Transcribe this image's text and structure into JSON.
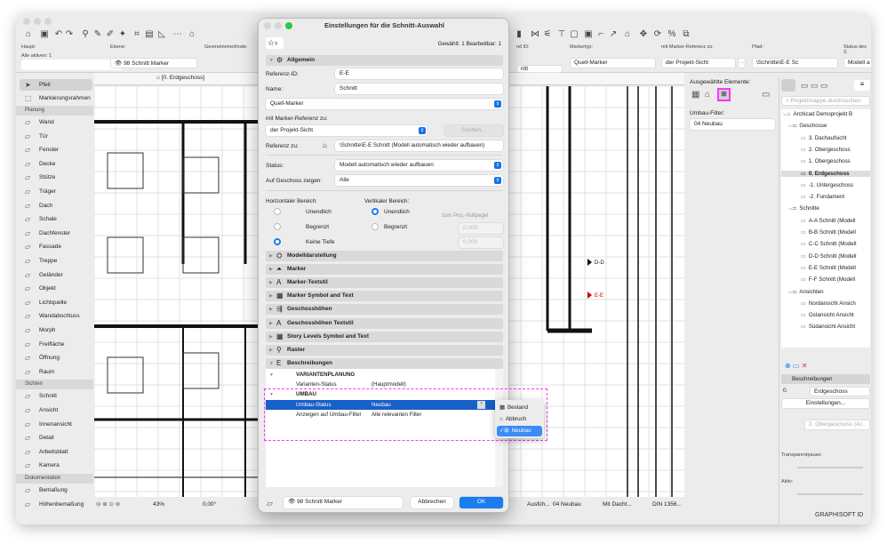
{
  "toolbar": {
    "icons": [
      "home-icon",
      "save-icon",
      "undo-icon",
      "redo-icon",
      "find-select-icon",
      "eyedropper-icon",
      "syringe-icon",
      "magic-wand-icon",
      "fit-icon",
      "layout-icon",
      "angle-icon",
      "snap-icon",
      "roof-icon",
      "wall-icon",
      "trim-icon",
      "adjust-icon",
      "intersect-icon",
      "offset-icon",
      "split-icon",
      "resize-icon",
      "stretch-icon",
      "elevate-icon",
      "move-icon",
      "rotate-icon",
      "percent-icon",
      "duplicate-icon"
    ]
  },
  "infobox": {
    "haupt_label": "Haupt:",
    "alle_aktiven": "Alle aktiven: 1",
    "ebene_label": "Ebene:",
    "ebene_value": "98 Schnitt Marker",
    "geometrie_label": "Geometriemethode:",
    "id_label": "nd ID:",
    "id_value": "nitt",
    "markertyp_label": "Markertyp:",
    "markertyp_value": "Quell-Marker",
    "marker_ref_label": "mit Marker-Referenz zu:",
    "marker_ref_value": "der Projekt-Sicht",
    "more_button": "...",
    "pfad_label": "Pfad:",
    "pfad_value": "\\Schnitte\\E-E Sc",
    "status_label": "Status des S",
    "status_value": "Modell a"
  },
  "view_tab": {
    "label": "[0. Erdgeschoss]"
  },
  "toolbox": {
    "top": [
      {
        "label": "Pfeil",
        "icon": "arrow-pointer-icon"
      },
      {
        "label": "Markierungsrahmen",
        "icon": "marquee-icon"
      }
    ],
    "sections": [
      {
        "title": "Planung",
        "items": [
          "Wand",
          "Tür",
          "Fenster",
          "Decke",
          "Stütze",
          "Träger",
          "Dach",
          "Schale",
          "Dachfenster",
          "Fassade",
          "Treppe",
          "Geländer",
          "Objekt",
          "Lichtquelle",
          "Wandabschluss",
          "Morph",
          "Freifläche",
          "Öffnung",
          "Raum"
        ]
      },
      {
        "title": "Sichten",
        "items": [
          "Schnitt",
          "Ansicht",
          "Innenansicht",
          "Detail",
          "Arbeitsblatt",
          "Kamera"
        ]
      },
      {
        "title": "Dokumentation",
        "items": [
          "Bemaßung",
          "Höhenbemaßung"
        ]
      }
    ]
  },
  "canvas": {
    "markers": [
      "D-D",
      "E-E"
    ],
    "marker_color": "#cc0000"
  },
  "statusbar": {
    "zoom": "43%",
    "angle": "0,00°",
    "item1": "Ausfüh...",
    "renovation": "04 Neubau",
    "model": "Mit Dacht...",
    "scale": "DIN 1356..."
  },
  "dialog": {
    "title": "Einstellungen für die Schnitt-Auswahl",
    "selection_info": "Gewählt: 1 Bearbeitbar: 1",
    "allgemein": "Allgemein",
    "ref_id_label": "Referenz-ID:",
    "ref_id_value": "E-E",
    "name_label": "Name:",
    "name_value": "Schnitt",
    "marker_type": "Quell-Marker",
    "marker_ref_label": "mit Marker-Referenz zu:",
    "marker_ref_value": "der Projekt-Sicht",
    "search_button": "Suchen...",
    "ref_to_label": "Referenz zu:",
    "ref_to_value": "\\Schnitte\\E-E Schnitt (Modell automatisch wieder aufbauen)",
    "status_label": "Status:",
    "status_value": "Modell automatisch wieder aufbauen",
    "geschoss_label": "Auf Geschoss zeigen:",
    "geschoss_value": "Alle",
    "horiz_label": "Horizontaler Bereich:",
    "horiz_options": [
      "Unendlich",
      "Begrenzt",
      "Keine Tiefe"
    ],
    "horiz_selected": "Keine Tiefe",
    "vert_label": "Vertikaler Bereich:",
    "vert_options": [
      "Unendlich",
      "Begrenzt"
    ],
    "vert_selected": "Unendlich",
    "nullpegel_label": "zum Proj.-Nullpegel",
    "val_top": "0,000",
    "val_bottom": "0,000",
    "panels": [
      "Modelldarstellung",
      "Marker",
      "Marker-Textstil",
      "Marker Symbol and Text",
      "Geschosshöhen",
      "Geschosshöhen Textstil",
      "Story Levels Symbol and Text",
      "Raster",
      "Beschreibungen"
    ],
    "table": {
      "group1": "VARIANTENPLANUNG",
      "row1_label": "Varianten-Status",
      "row1_value": "(Hauptmodell)",
      "group2": "UMBAU",
      "row2_label": "Umbau-Status",
      "row2_value": "Neubau",
      "row3_label": "Anzeigen auf Umbau-Filter",
      "row3_value": "Alle relevanten Filter"
    },
    "popup": {
      "options": [
        "Bestand",
        "Abbruch",
        "Neubau"
      ],
      "selected": "Neubau"
    },
    "layer_value": "98 Schnitt Marker",
    "cancel": "Abbrechen",
    "ok": "OK",
    "highlight_color": "#ff33ff",
    "accent": "#1a7cf0"
  },
  "selected_elements": {
    "label": "Ausgewählte Elemente:",
    "filter_label": "Umbau-Filter:",
    "filter_value": "04 Neubau"
  },
  "navigator": {
    "search_placeholder": "Projektmappe durchsuchen",
    "root": "Archicad Demoprojekt B",
    "groups": [
      {
        "title": "Geschosse",
        "items": [
          "3. Dachaufsicht",
          "2. Obergeschoss",
          "1. Obergeschoss",
          "0. Erdgeschoss",
          "-1. Untergeschoss",
          "-2. Fundament"
        ],
        "selected": "0. Erdgeschoss"
      },
      {
        "title": "Schnitte",
        "items": [
          "A-A Schnitt (Modell",
          "B-B Schnitt (Modell",
          "C-C Schnitt (Modell",
          "D-D Schnitt (Modell",
          "E-E Schnitt (Modell",
          "F-F Schnitt (Modell"
        ]
      },
      {
        "title": "Ansichten",
        "items": [
          "Nordansicht Ansich",
          "Ostansicht Ansicht",
          "Südansicht Ansicht"
        ]
      }
    ],
    "desc_header": "Beschreibungen",
    "desc_num": "0.",
    "desc_name": "Erdgeschoss",
    "settings_button": "Einstellungen...",
    "trace_ref": "2. Obergeschoss (Ar...",
    "transparency_label": "Transparentpause:",
    "active_label": "Aktiv:",
    "footer": "GRAPHISOFT ID"
  }
}
